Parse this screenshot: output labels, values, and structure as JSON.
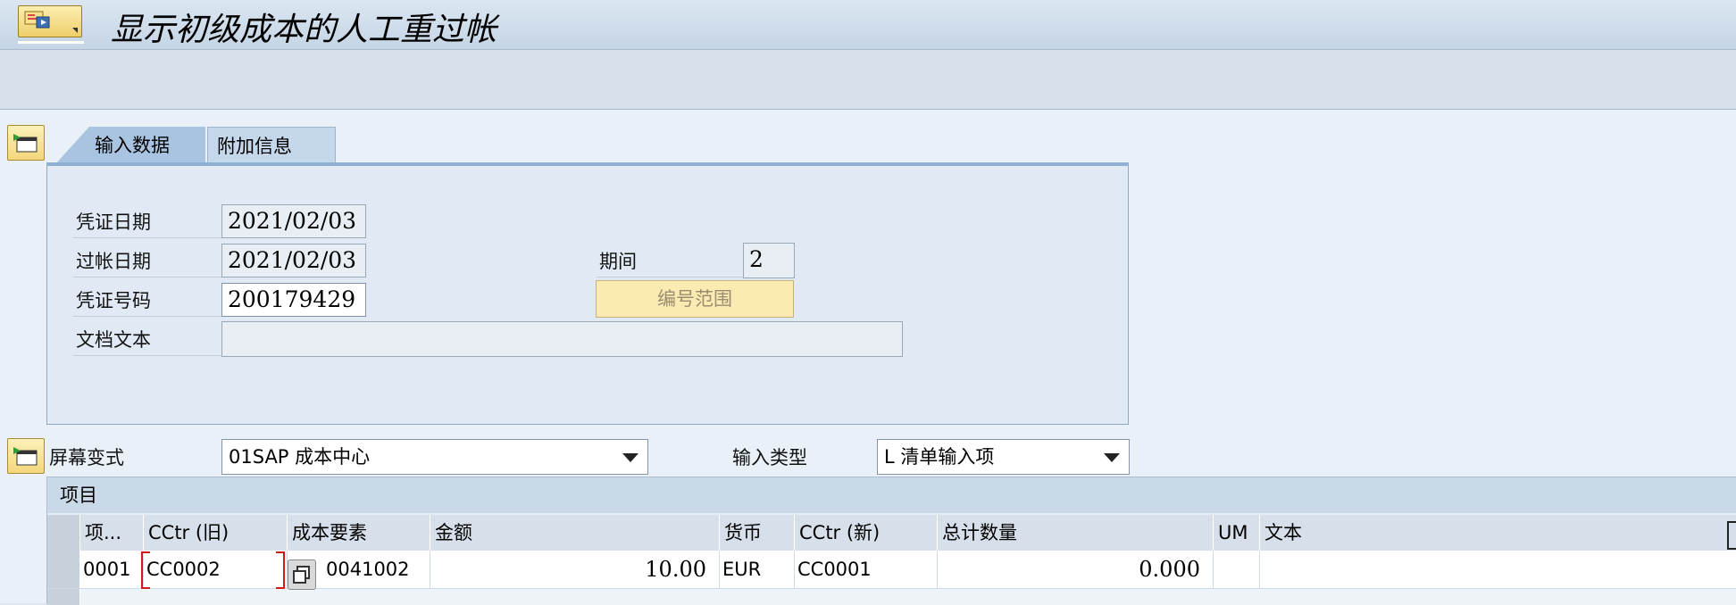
{
  "window": {
    "title": "显示初级成本的人工重过帐"
  },
  "tabs": [
    {
      "label": "输入数据"
    },
    {
      "label": "附加信息"
    }
  ],
  "form": {
    "doc_date": {
      "label": "凭证日期",
      "value": "2021/02/03"
    },
    "posting_date": {
      "label": "过帐日期",
      "value": "2021/02/03"
    },
    "doc_number": {
      "label": "凭证号码",
      "value": "200179429"
    },
    "doc_text": {
      "label": "文档文本",
      "value": ""
    },
    "period": {
      "label": "期间",
      "value": "2"
    },
    "number_range_button": "编号范围"
  },
  "screen_variant": {
    "label": "屏幕变式",
    "value": "01SAP 成本中心"
  },
  "input_type": {
    "label": "输入类型",
    "value": "L 清单输入项"
  },
  "table": {
    "title": "项目",
    "columns": [
      "项...",
      "CCtr (旧)",
      "成本要素",
      "金额",
      "货币",
      "CCtr (新)",
      "总计数量",
      "UM",
      "文本"
    ],
    "rows": [
      {
        "item": "0001",
        "cctr_old": "CC0002",
        "cost_element": "0041002",
        "amount": "10.00",
        "currency": "EUR",
        "cctr_new": "CC0001",
        "quantity": "0.000",
        "um": "",
        "text": ""
      }
    ]
  },
  "colors": {
    "accent_yellow": "#f3d77b",
    "tab_active": "#a9c4e0",
    "title_bar": "#c5d5e5",
    "error_red": "#d01a1a"
  },
  "icons": [
    "sap-menu-icon",
    "expand-panel-icon",
    "copy-icon",
    "dropdown-caret-icon"
  ]
}
